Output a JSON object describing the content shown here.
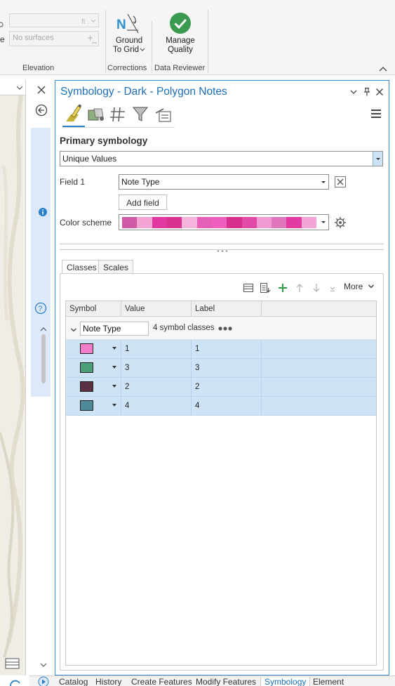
{
  "ribbon": {
    "surface_placeholder": "No surfaces",
    "cut_letter": "e",
    "ground_to_grid_line1": "Ground",
    "ground_to_grid_line2": "To Grid",
    "manage_quality_line1": "Manage",
    "manage_quality_line2": "Quality",
    "groups": {
      "elevation": "Elevation",
      "corrections": "Corrections",
      "data_reviewer": "Data Reviewer"
    }
  },
  "pane": {
    "title": "Symbology - Dark - Polygon Notes",
    "primary_symbology_heading": "Primary symbology",
    "renderer": "Unique Values",
    "field1_label": "Field 1",
    "field1_value": "Note Type",
    "add_field_label": "Add field",
    "color_scheme_label": "Color scheme",
    "color_scheme_ramp": [
      "#d15aa6",
      "#f3a6d3",
      "#e03aa2",
      "#d8338f",
      "#f4b4dc",
      "#e55fb9",
      "#ef5fbd",
      "#d62f8e",
      "#e24aa7",
      "#f29ad3",
      "#e077bd",
      "#e13aa3",
      "#f3a5d6"
    ],
    "tabs": [
      "Classes",
      "Scales"
    ],
    "more_label": "More",
    "grid": {
      "headers": [
        "Symbol",
        "Value",
        "Label"
      ],
      "group_field": "Note Type",
      "group_count": "4 symbol classes",
      "rows": [
        {
          "color": "#f07ec8",
          "value": "1",
          "label": "1"
        },
        {
          "color": "#4c9f78",
          "value": "3",
          "label": "3"
        },
        {
          "color": "#5a3042",
          "value": "2",
          "label": "2"
        },
        {
          "color": "#4e8a98",
          "value": "4",
          "label": "4"
        }
      ]
    }
  },
  "bottom_tabs": [
    "Catalog",
    "History",
    "Create Features",
    "Modify Features",
    "Symbology",
    "Element"
  ],
  "accent": "#1c6fb8"
}
